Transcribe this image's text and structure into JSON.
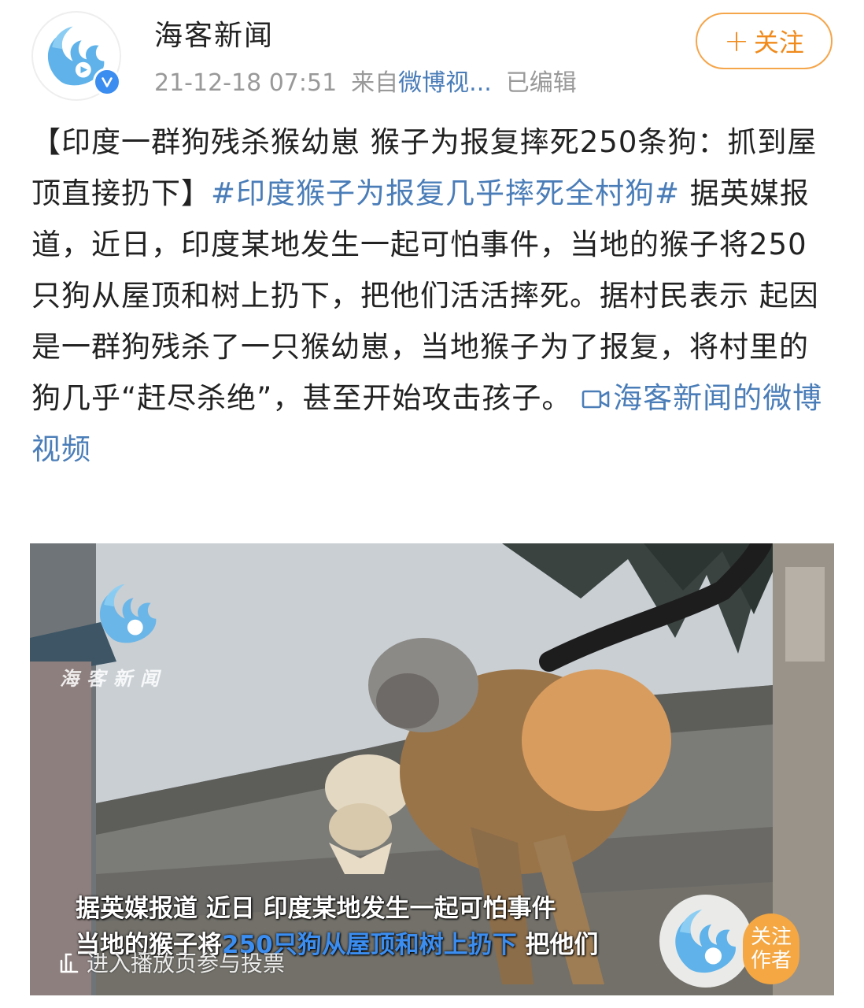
{
  "header": {
    "account_name": "海客新闻",
    "timestamp": "21-12-18 07:51",
    "source_prefix": "来自",
    "source_link": "微博视...",
    "edited_label": "已编辑",
    "follow_plus": "+",
    "follow_label": "关注",
    "verified_icon": "verified-v-icon"
  },
  "post": {
    "headline": "【印度一群狗残杀猴幼崽 猴子为报复摔死250条狗：抓到屋顶直接扔下】",
    "hashtag": "#印度猴子为报复几乎摔死全村狗#",
    "body": " 据英媒报道，近日，印度某地发生一起可怕事件，当地的猴子将250只狗从屋顶和树上扔下，把他们活活摔死。据村民表示 起因是一群狗残杀了一只猴幼崽，当地猴子为了报复，将村里的狗几乎“赶尽杀绝”，甚至开始攻击孩子。 ",
    "video_link": "海客新闻的微博视频",
    "video_icon": "video-camera-icon"
  },
  "video": {
    "watermark": "海客新闻",
    "subtitle_line1": "据英媒报道 近日 印度某地发生一起可怕事件",
    "subtitle_line2_a": "当地的猴子将",
    "subtitle_line2_b": "250只狗从屋顶和树上扔下",
    "subtitle_line2_c": "把他们",
    "play_hint": "进入播放页参与投票",
    "author_follow_line1": "关注",
    "author_follow_line2": "作者"
  },
  "colors": {
    "link_blue": "#4a7db8",
    "follow_orange": "#f08a1b",
    "badge_orange": "#f4a742",
    "verified_blue": "#3b8df0"
  }
}
